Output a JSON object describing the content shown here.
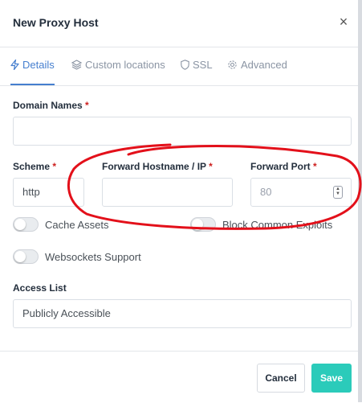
{
  "modal": {
    "title": "New Proxy Host",
    "close_glyph": "×"
  },
  "tabs": [
    {
      "label": "Details",
      "icon": "lightning-icon",
      "active": true
    },
    {
      "label": "Custom locations",
      "icon": "layers-icon",
      "active": false
    },
    {
      "label": "SSL",
      "icon": "shield-icon",
      "active": false
    },
    {
      "label": "Advanced",
      "icon": "gear-icon",
      "active": false
    }
  ],
  "form": {
    "domain_names": {
      "label": "Domain Names",
      "required_mark": "*",
      "value": ""
    },
    "scheme": {
      "label": "Scheme",
      "required_mark": "*",
      "value": "http"
    },
    "forward_hostname": {
      "label": "Forward Hostname / IP",
      "required_mark": "*",
      "value": ""
    },
    "forward_port": {
      "label": "Forward Port",
      "required_mark": "*",
      "placeholder": "80"
    },
    "toggles": {
      "cache_assets": {
        "label": "Cache Assets",
        "on": false
      },
      "block_exploits": {
        "label": "Block Common Exploits",
        "on": false
      },
      "websockets": {
        "label": "Websockets Support",
        "on": false
      }
    },
    "access_list": {
      "label": "Access List",
      "value": "Publicly Accessible"
    }
  },
  "footer": {
    "cancel_label": "Cancel",
    "save_label": "Save"
  },
  "colors": {
    "accent": "#467fcf",
    "save": "#2bcbba",
    "required": "#cd201f",
    "annotation": "#e3101a"
  }
}
